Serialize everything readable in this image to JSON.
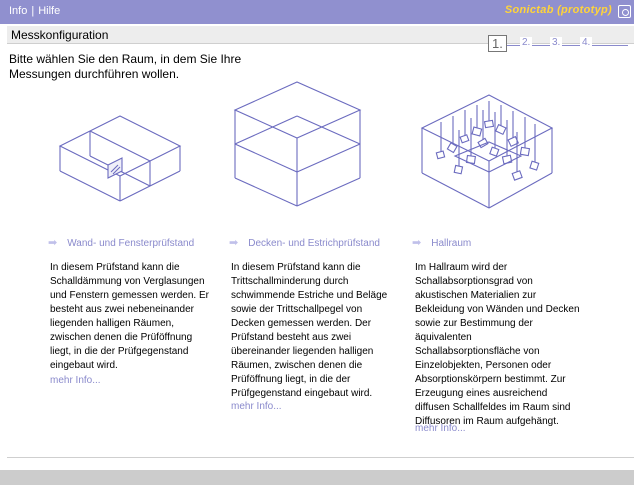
{
  "menu": {
    "info": "Info",
    "separator": "|",
    "help": "Hilfe"
  },
  "brand": "Sonictab (prototyp)",
  "page_title": "Messkonfiguration",
  "steps": [
    "1.",
    "2.",
    "3.",
    "4."
  ],
  "intro": "Bitte wählen Sie den Raum, in dem Sie Ihre Messungen durchführen wollen.",
  "options": [
    {
      "title": "Wand- und Fensterprüfstand",
      "description": "In diesem Prüfstand kann die Schalldämmung von Verglasungen und Fenstern gemessen werden. Er besteht aus zwei nebeneinander liegenden halligen Räumen, zwischen denen die Prüföffnung liegt, in die der Prüfgegenstand eingebaut wird.",
      "more": "mehr Info..."
    },
    {
      "title": "Decken- und Estrichprüfstand",
      "description": "In diesem Prüfstand kann die Trittschallminderung durch schwimmende Estriche und Beläge sowie der Trittschallpegel von Decken gemessen werden. Der Prüfstand besteht aus zwei übereinander liegenden halligen Räumen, zwischen denen die Prüföffnung liegt, in die der Prüfgegenstand eingebaut wird.",
      "more": "mehr Info..."
    },
    {
      "title": "Hallraum",
      "description": "Im Hallraum wird der Schallabsorptionsgrad von akustischen Materialien zur Bekleidung von Wänden und Decken sowie zur Bestimmung der äquivalenten Schallabsorptionsfläche von Einzelobjekten, Personen oder Absorptionskörpern bestimmt. Zur Erzeugung eines ausreichend diffusen Schallfeldes im Raum sind Diffusoren im Raum aufgehängt.",
      "more": "mehr Info..."
    }
  ],
  "icons": {
    "option_arrow": "arrow-right-icon",
    "corner": "help-circle-icon"
  },
  "colors": {
    "topbar": "#9090cf",
    "accent": "#8a8acc",
    "brand": "#ffd43a",
    "line_art": "#6b6bbf"
  }
}
